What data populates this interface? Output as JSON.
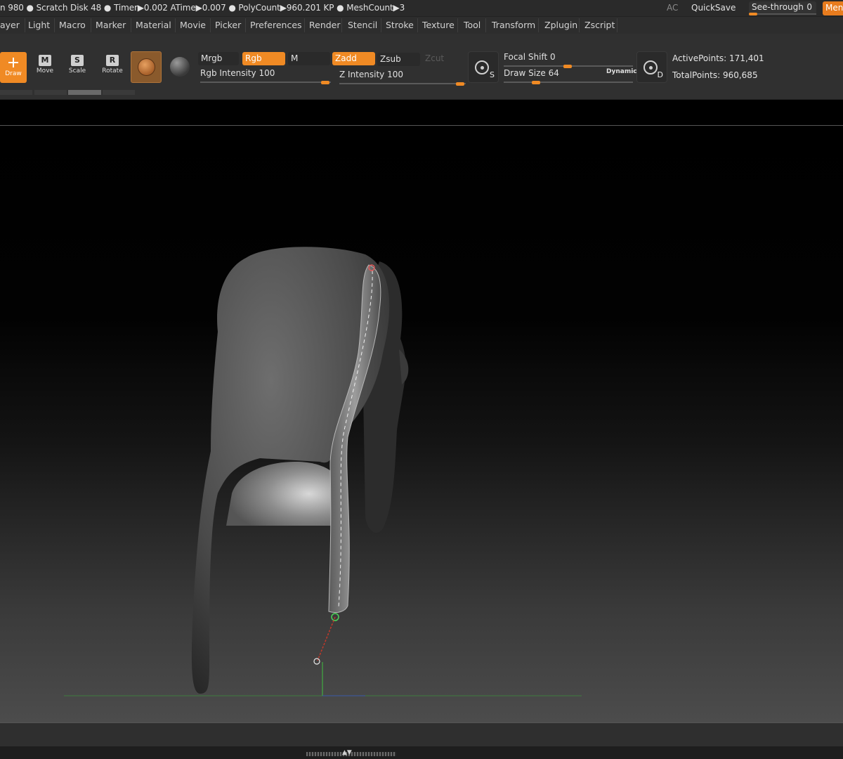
{
  "status": {
    "text": "n 980 ● Scratch Disk 48 ●  Timer▶0.002 ATime▶0.007 ● PolyCount▶960.201 KP  ● MeshCount▶3",
    "ac": "AC",
    "quicksave": "QuickSave",
    "seethrough_label": "See-through",
    "seethrough_value": "0",
    "menus_label": "Men"
  },
  "menubar": {
    "items": [
      "ayer",
      "Light",
      "Macro",
      "Marker",
      "Material",
      "Movie",
      "Picker",
      "Preferences",
      "Render",
      "Stencil",
      "Stroke",
      "Texture",
      "Tool",
      "Transform",
      "Zplugin",
      "Zscript"
    ]
  },
  "shelf": {
    "draw_label": "Draw",
    "move_label": "Move",
    "move_glyph": "M",
    "scale_label": "Scale",
    "scale_glyph": "S",
    "rotate_label": "Rotate",
    "rotate_glyph": "R",
    "mrgb": "Mrgb",
    "rgb": "Rgb",
    "m": "M",
    "zadd": "Zadd",
    "zsub": "Zsub",
    "zcut": "Zcut",
    "rgb_intensity_label": "Rgb Intensity",
    "rgb_intensity_value": "100",
    "z_intensity_label": "Z Intensity",
    "z_intensity_value": "100",
    "focal_shift_label": "Focal Shift",
    "focal_shift_value": "0",
    "draw_size_label": "Draw Size",
    "draw_size_value": "64",
    "dynamic_label": "Dynamic",
    "focal_s_letter": "S",
    "focal_d_letter": "D",
    "active_points_label": "ActivePoints:",
    "active_points_value": "171,401",
    "total_points_label": "TotalPoints:",
    "total_points_value": "960,685"
  },
  "colors": {
    "accent": "#f08a24",
    "panel": "#303030",
    "canvas_top": "#000000",
    "canvas_bottom": "#4c4c4c"
  },
  "icons": {
    "draw": "crosshair-icon",
    "brush": "brush-icon",
    "material": "material-sphere-icon",
    "focal": "focal-target-icon"
  }
}
